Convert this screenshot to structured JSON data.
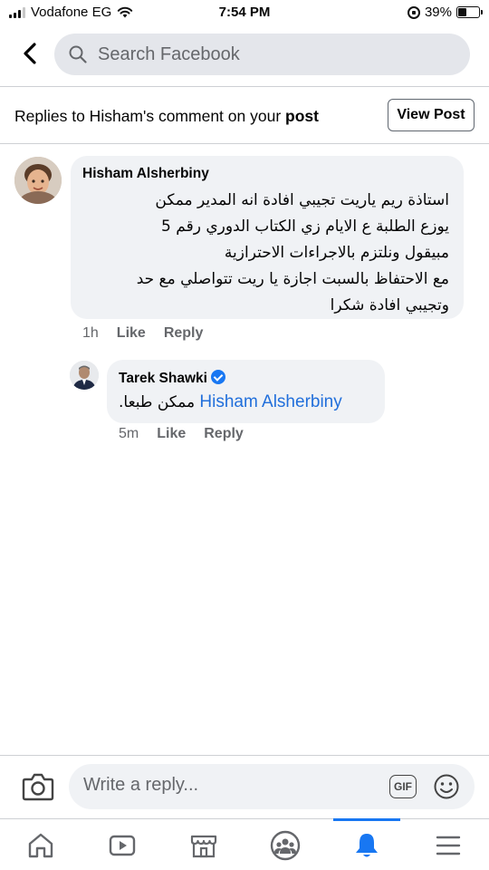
{
  "status_bar": {
    "carrier": "Vodafone EG",
    "time": "7:54 PM",
    "battery": "39%",
    "battery_level": 0.39
  },
  "search": {
    "placeholder": "Search Facebook"
  },
  "context": {
    "prefix": "Replies to Hisham's comment on your ",
    "emphasis": "post",
    "view_post_label": "View Post"
  },
  "comments": [
    {
      "author": "Hisham Alsherbiny",
      "lines": [
        "استاذة ريم ياريت تجيبي افادة انه المدير ممكن",
        "يوزع الطلبة ع الايام زي الكتاب الدوري  رقم 5",
        "مبيقول ونلتزم بالاجراءات الاحترازية",
        "مع الاحتفاظ بالسبت اجازة يا ريت تتواصلي مع حد",
        "وتجيبي افادة شكرا"
      ],
      "time": "1h",
      "like_label": "Like",
      "reply_label": "Reply"
    },
    {
      "author": "Tarek Shawki",
      "verified": true,
      "mention": "Hisham Alsherbiny",
      "text": "ممكن طبعا.",
      "time": "5m",
      "like_label": "Like",
      "reply_label": "Reply"
    }
  ],
  "composer": {
    "placeholder": "Write a reply...",
    "gif_label": "GIF"
  },
  "colors": {
    "accent": "#1877f2",
    "mention": "#216fdb",
    "bubble": "#f0f2f5",
    "secondary_text": "#65676b"
  },
  "nav": {
    "items": [
      "home-icon",
      "watch-icon",
      "marketplace-icon",
      "groups-icon",
      "notifications-icon",
      "menu-icon"
    ],
    "active": "notifications-icon"
  }
}
